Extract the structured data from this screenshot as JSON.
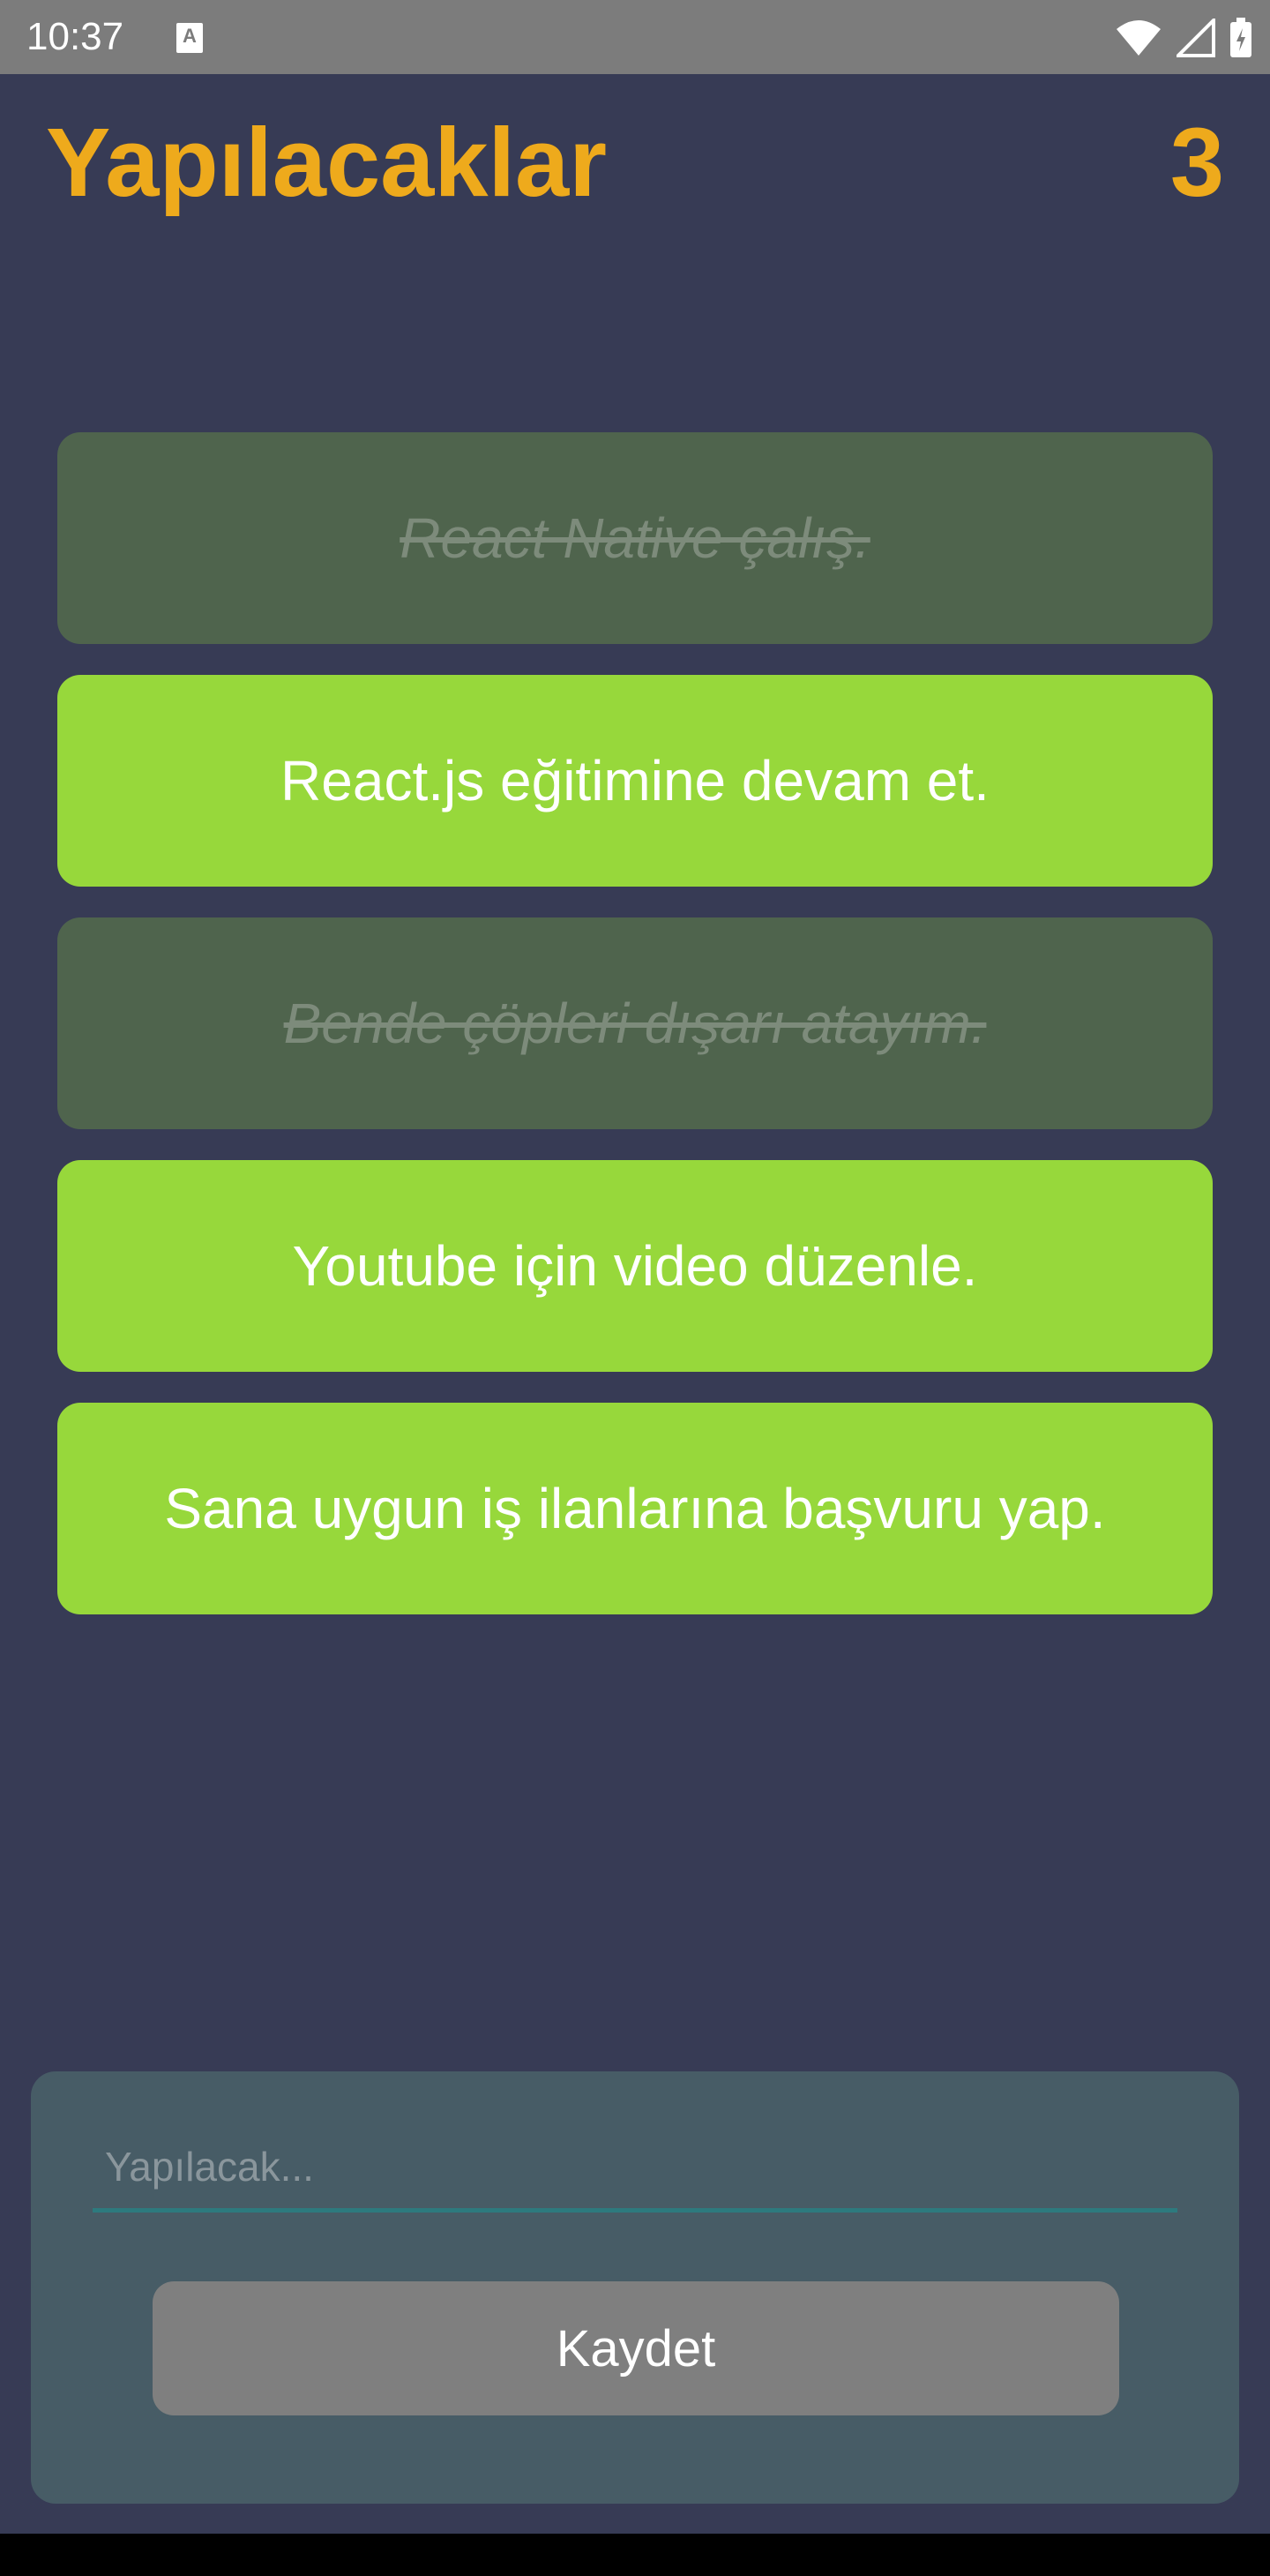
{
  "status_bar": {
    "time": "10:37",
    "notification_icon": "A"
  },
  "header": {
    "title": "Yapılacaklar",
    "count": "3"
  },
  "todos": [
    {
      "text": "React Native çalış.",
      "done": true
    },
    {
      "text": "React.js eğitimine devam et.",
      "done": false
    },
    {
      "text": "Bende çöpleri dışarı atayım.",
      "done": true
    },
    {
      "text": "Youtube için video düzenle.",
      "done": false
    },
    {
      "text": "Sana uygun iş ilanlarına başvuru yap.",
      "done": false
    }
  ],
  "form": {
    "placeholder": "Yapılacak...",
    "value": "",
    "save_label": "Kaydet"
  },
  "colors": {
    "background": "#373b55",
    "accent": "#eeaa1c",
    "active_item": "#97d83b",
    "done_item": "#4f644d",
    "card": "#475c66",
    "button": "#7f7f7f"
  },
  "icons": [
    "wifi-icon",
    "cell-signal-icon",
    "battery-icon"
  ]
}
